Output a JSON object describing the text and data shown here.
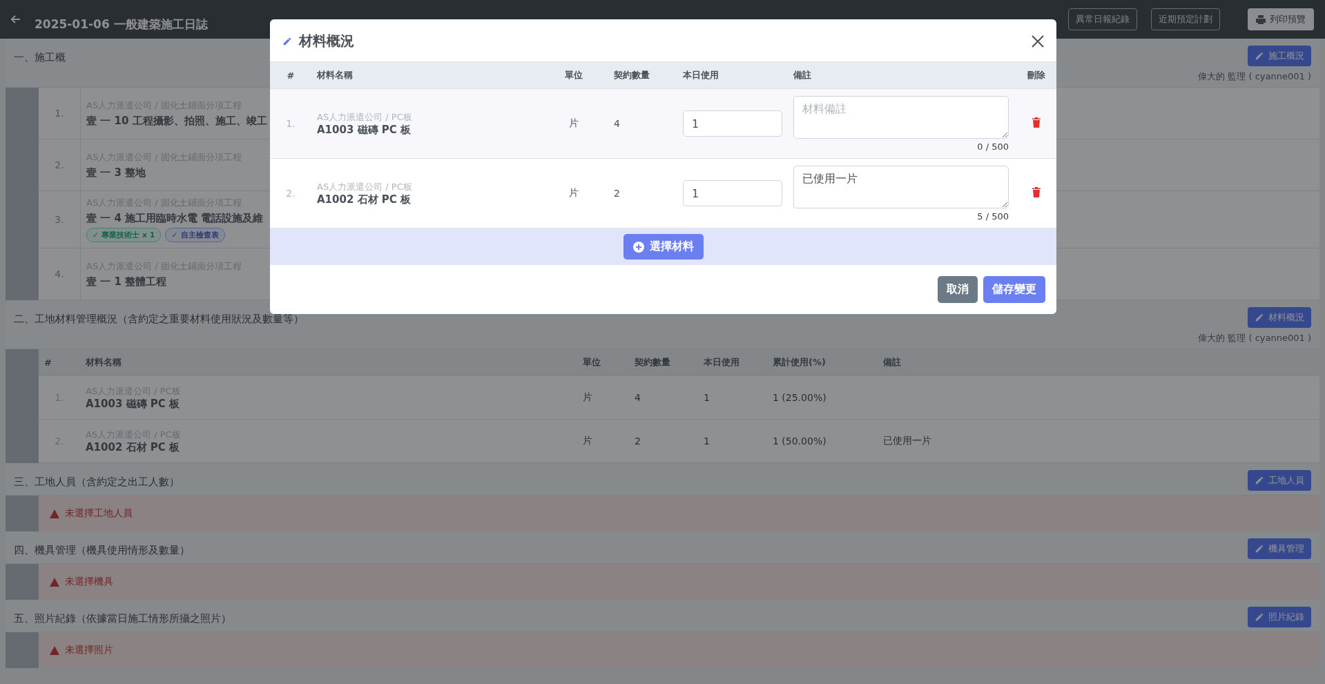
{
  "header": {
    "title": "2025-01-06 一般建築施工日誌",
    "buttons": [
      "異常日報紀錄",
      "近期預定計劃"
    ],
    "print_button": "列印預覽"
  },
  "sections": [
    {
      "kind": "tasks",
      "title": "一、施工概",
      "button": "施工概況",
      "author": "偉大的 監理 ( cyanne001 )",
      "rows": [
        {
          "index": "1.",
          "company": "AS人力派遣公司 / 固化土鋪面分項工程",
          "name": "壹 一 10 工程攝影、拍照、施工、竣工",
          "tags": []
        },
        {
          "index": "2.",
          "company": "AS人力派遣公司 / 固化土鋪面分項工程",
          "name": "壹 一 3 整地",
          "tags": []
        },
        {
          "index": "3.",
          "company": "AS人力派遣公司 / 固化土鋪面分項工程",
          "name": "壹 一 4 施工用臨時水電 電話設施及維",
          "tags": [
            {
              "label": "✓ 專業技術士 x 1",
              "kind": "staff"
            },
            {
              "label": "✓ 自主檢查表",
              "kind": "checklist"
            }
          ]
        },
        {
          "index": "4.",
          "company": "AS人力派遣公司 / 固化土鋪面分項工程",
          "name": "壹 一 1 整體工程",
          "tags": []
        }
      ]
    },
    {
      "kind": "materials",
      "title": "二、工地材料管理概況（含約定之重要材料使用狀況及數量等）",
      "button": "材料概況",
      "author": "偉大的 監理 ( cyanne001 )",
      "columns": [
        "#",
        "材料名稱",
        "單位",
        "契約數量",
        "本日使用",
        "累計使用(%)",
        "備註"
      ],
      "rows": [
        {
          "index": "1.",
          "source": "AS人力派遣公司 / PC板",
          "name": "A1003 磁磚 PC 板",
          "unit": "片",
          "contract": "4",
          "used": "1",
          "total": "1 (25.00%)"
        },
        {
          "index": "2.",
          "source": "AS人力派遣公司 / PC板",
          "name": "A1002 石材 PC 板",
          "unit": "片",
          "contract": "2",
          "used": "1",
          "total": "1 (50.00%)",
          "note": "已使用一片"
        }
      ]
    },
    {
      "kind": "empty",
      "title": "三、工地人員（含約定之出工人數）",
      "button": "工地人員",
      "warning": "未選擇工地人員"
    },
    {
      "kind": "empty",
      "title": "四、機具管理（機具使用情形及數量）",
      "button": "機具管理",
      "warning": "未選擇機具"
    },
    {
      "kind": "empty",
      "title": "五、照片紀錄（依據當日施工情形所攝之照片）",
      "button": "照片紀錄",
      "warning": "未選擇照片"
    }
  ],
  "modal": {
    "title": "材料概況",
    "columns": [
      "#",
      "材料名稱",
      "單位",
      "契約數量",
      "本日使用",
      "備註",
      "刪除"
    ],
    "rows": [
      {
        "index": "1.",
        "source": "AS人力派遣公司 / PC板",
        "name": "A1003 磁磚 PC 板",
        "unit": "片",
        "contract": "4",
        "used": "1",
        "placeholder": "材料備註",
        "count": "0 / 500"
      },
      {
        "index": "2.",
        "source": "AS人力派遣公司 / PC板",
        "name": "A1002 石材 PC 板",
        "unit": "片",
        "contract": "2",
        "used": "1",
        "note": "已使用一片",
        "count": "5 / 500"
      }
    ],
    "add_button": "選擇材料",
    "buttons": [
      {
        "label": "取消",
        "kind": "secondary"
      },
      {
        "label": "儲存變更",
        "kind": "primary"
      }
    ]
  }
}
